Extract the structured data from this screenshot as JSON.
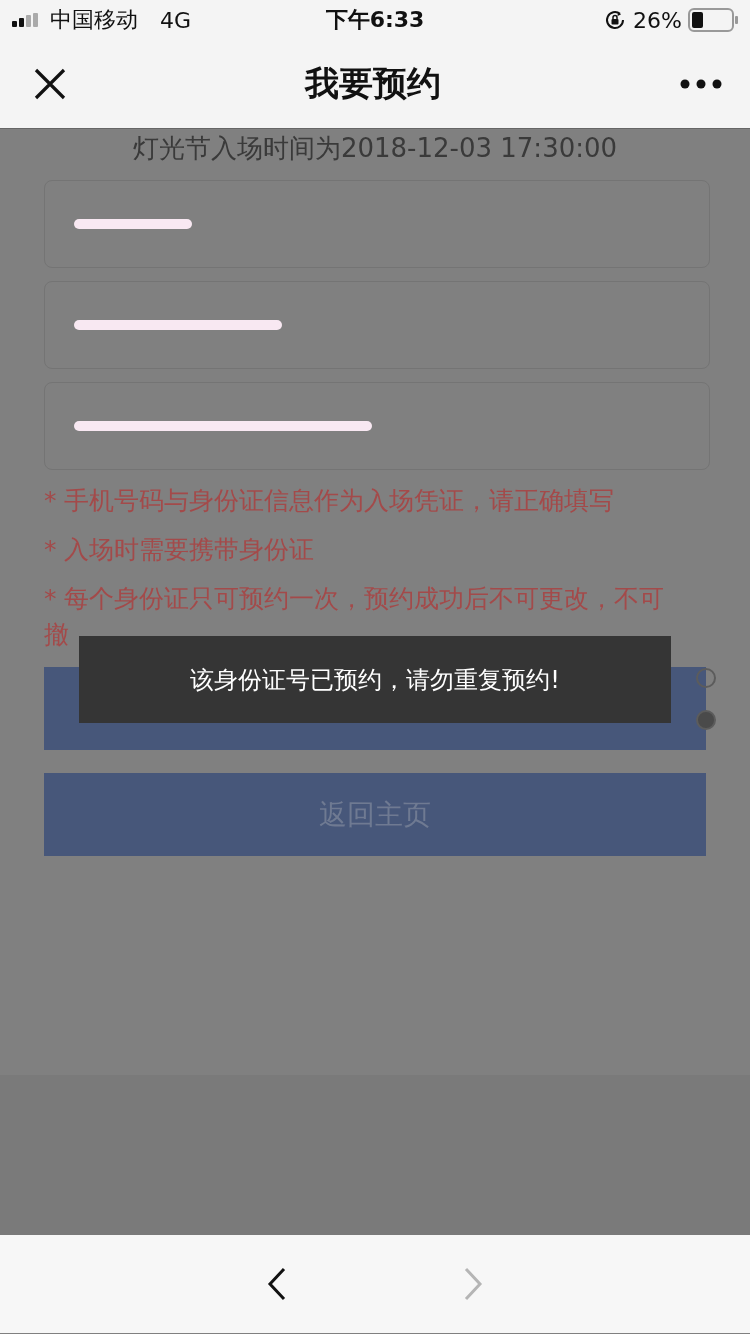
{
  "status_bar": {
    "carrier": "中国移动",
    "network": "4G",
    "time": "下午6:33",
    "battery_percent": "26%"
  },
  "nav": {
    "title": "我要预约"
  },
  "intro": "灯光节入场时间为2018-12-03 17:30:00",
  "fields": [
    {
      "redacted": true
    },
    {
      "redacted": true
    },
    {
      "redacted": true
    }
  ],
  "notes": [
    "* 手机号码与身份证信息作为入场凭证，请正确填写",
    "* 入场时需要携带身份证",
    "* 每个身份证只可预约一次，预约成功后不可更改，不可撤"
  ],
  "radios": [
    {
      "selected": false
    },
    {
      "selected": true
    }
  ],
  "home_button": "返回主页",
  "toast": "该身份证号已预约，请勿重复预约!",
  "toolbar": {
    "back_disabled": false,
    "forward_disabled": true
  }
}
